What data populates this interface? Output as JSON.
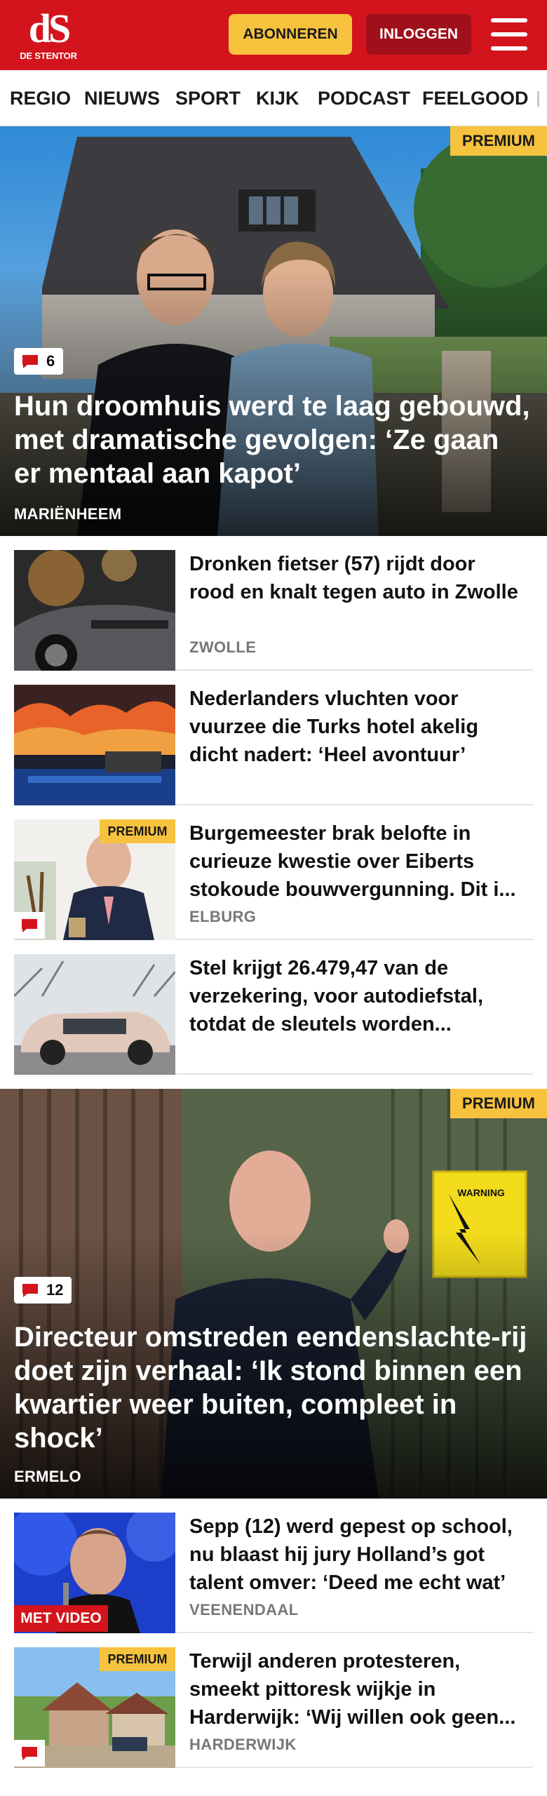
{
  "header": {
    "logo_mark": "dS",
    "logo_text": "DE STENTOR",
    "subscribe_label": "ABONNEREN",
    "login_label": "INLOGGEN",
    "brand_color": "#d3141c",
    "accent_color": "#f7c23d"
  },
  "nav": {
    "items": [
      "REGIO",
      "NIEUWS",
      "SPORT",
      "KIJK",
      "PODCAST",
      "FEELGOOD"
    ]
  },
  "hero1": {
    "tag": "PREMIUM",
    "comments": "6",
    "title": "Hun droomhuis werd te laag gebouwd, met dramatische gevolgen: ‘Ze gaan er mentaal aan kapot’",
    "location": "MARIËNHEEM"
  },
  "list1": [
    {
      "title": "Dronken fietser (57) rijdt door rood en knalt tegen auto in Zwolle",
      "location": "ZWOLLE"
    },
    {
      "title": "Nederlanders vluchten voor vuurzee die Turks hotel akelig dicht nadert: ‘Heel avontuur’",
      "location": ""
    },
    {
      "tag": "PREMIUM",
      "title": "Burgemeester brak belofte in curieuze kwestie over Eiberts stokoude bouwvergunning. Dit i...",
      "location": "ELBURG"
    },
    {
      "title": "Stel krijgt 26.479,47 van de verzekering, voor autodiefstal, totdat de sleutels worden...",
      "location": ""
    }
  ],
  "hero2": {
    "tag": "PREMIUM",
    "comments": "12",
    "title": "Directeur omstreden eendenslachte-rij doet zijn verhaal: ‘Ik stond binnen een kwartier weer buiten, compleet in shock’",
    "location": "ERMELO",
    "sign_text": "WARNING"
  },
  "list2": [
    {
      "badge": "MET VIDEO",
      "title": "Sepp (12) werd gepest op school, nu blaast hij jury Holland’s got talent omver: ‘Deed me echt wat’",
      "location": "VEENENDAAL"
    },
    {
      "tag": "PREMIUM",
      "title": "Terwijl anderen protesteren, smeekt pittoresk wijkje in Harderwijk: ‘Wij willen ook geen...",
      "location": "HARDERWIJK"
    }
  ]
}
